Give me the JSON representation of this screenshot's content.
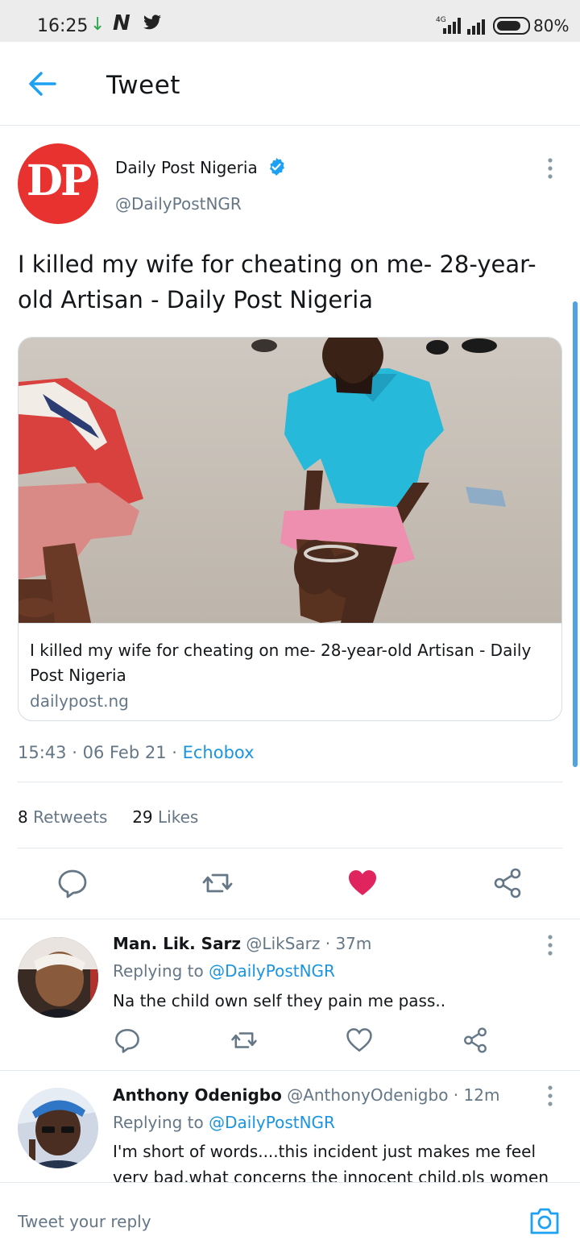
{
  "status_bar": {
    "time": "16:25",
    "network": "4G",
    "battery": "80%",
    "battery_level": 0.8
  },
  "header": {
    "title": "Tweet"
  },
  "tweet": {
    "author_name": "Daily Post Nigeria",
    "author_handle": "@DailyPostNGR",
    "avatar_text": "DP",
    "text": "I killed my wife for cheating on me- 28-year-old Artisan - Daily Post Nigeria",
    "card": {
      "title": "I killed my wife for cheating on me- 28-year-old Artisan - Daily Post Nigeria",
      "domain": "dailypost.ng"
    },
    "time": "15:43",
    "date": "06 Feb 21",
    "source": "Echobox",
    "retweets_count": "8",
    "retweets_label": "Retweets",
    "likes_count": "29",
    "likes_label": "Likes",
    "liked": true
  },
  "replies": [
    {
      "name": "Man. Lik. Sarz",
      "handle": "@LikSarz",
      "time": "37m",
      "replying_label": "Replying to",
      "replying_to": "@DailyPostNGR",
      "text": "Na the child own self they pain me pass.."
    },
    {
      "name": "Anthony Odenigbo",
      "handle": "@AnthonyOdenigbo",
      "time": "12m",
      "replying_label": "Replying to",
      "replying_to": "@DailyPostNGR",
      "text": "I'm short of words....this incident just makes me feel very bad.what concerns the innocent child.pls women"
    }
  ],
  "composer": {
    "placeholder": "Tweet your reply"
  },
  "colors": {
    "accent": "#1da1f2",
    "like": "#e0245e",
    "text": "#14171a",
    "secondary": "#657786",
    "dp_red": "#e8322f"
  },
  "icons": [
    "back-arrow-icon",
    "verified-badge-icon",
    "more-vertical-icon",
    "reply-icon",
    "retweet-icon",
    "heart-icon",
    "share-icon",
    "camera-icon"
  ]
}
